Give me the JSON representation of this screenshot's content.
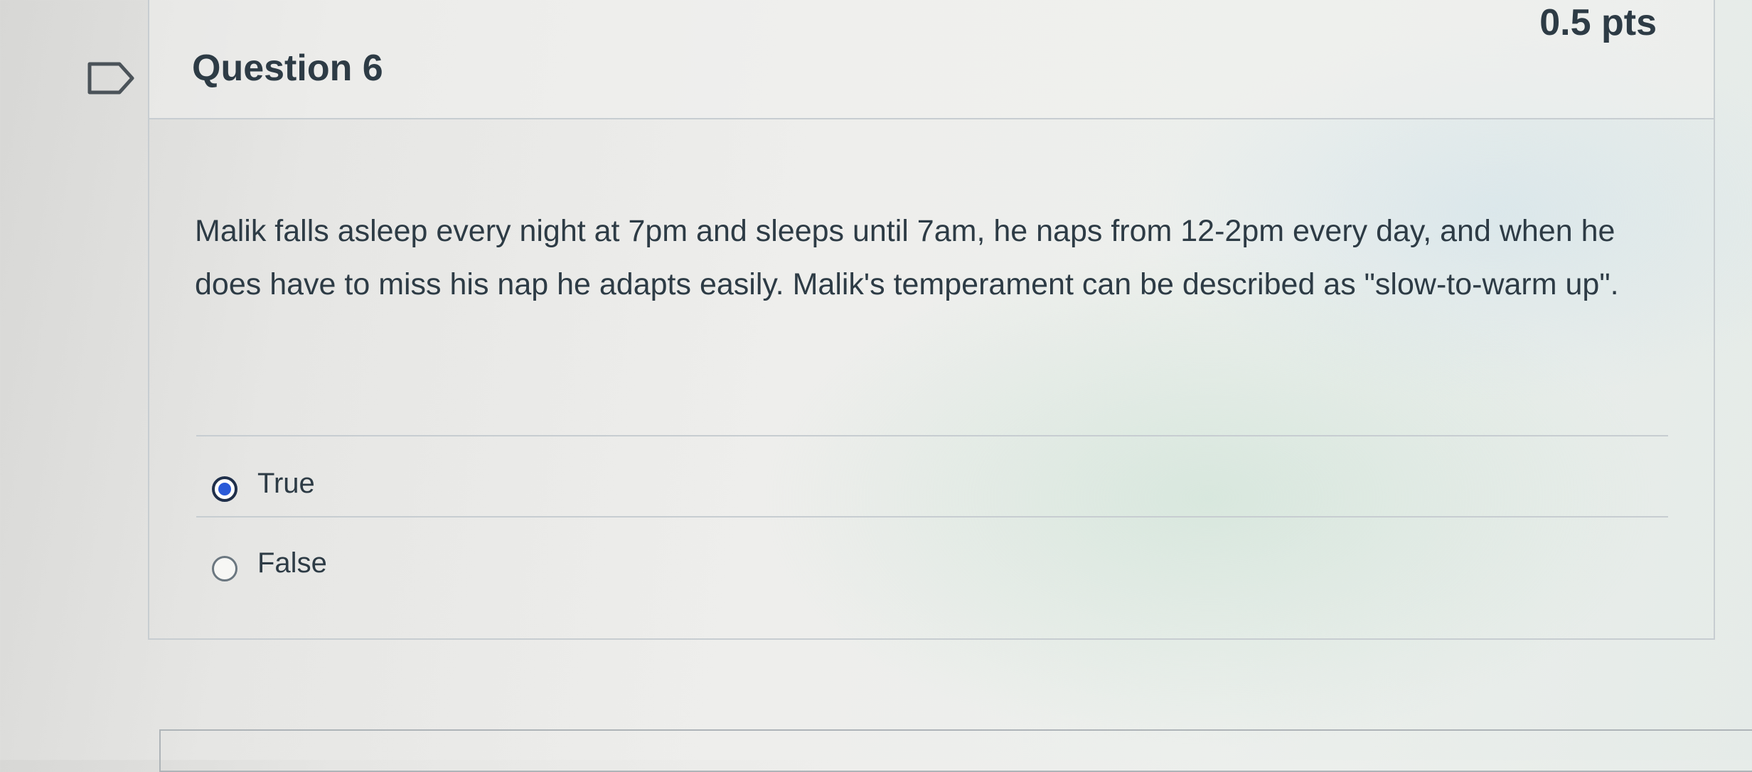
{
  "question": {
    "title": "Question 6",
    "points": "0.5 pts",
    "flag_icon": "flag-icon",
    "text": "Malik falls asleep every night at 7pm and sleeps until 7am, he naps from 12-2pm every day, and when he does have to miss his nap he adapts easily. Malik's temperament can be described as \"slow-to-warm up\".",
    "answers": [
      {
        "label": "True",
        "selected": true
      },
      {
        "label": "False",
        "selected": false
      }
    ]
  },
  "colors": {
    "text": "#2d3b45",
    "border": "#c7cdd1",
    "radio_selected": "#2a5ad8"
  }
}
